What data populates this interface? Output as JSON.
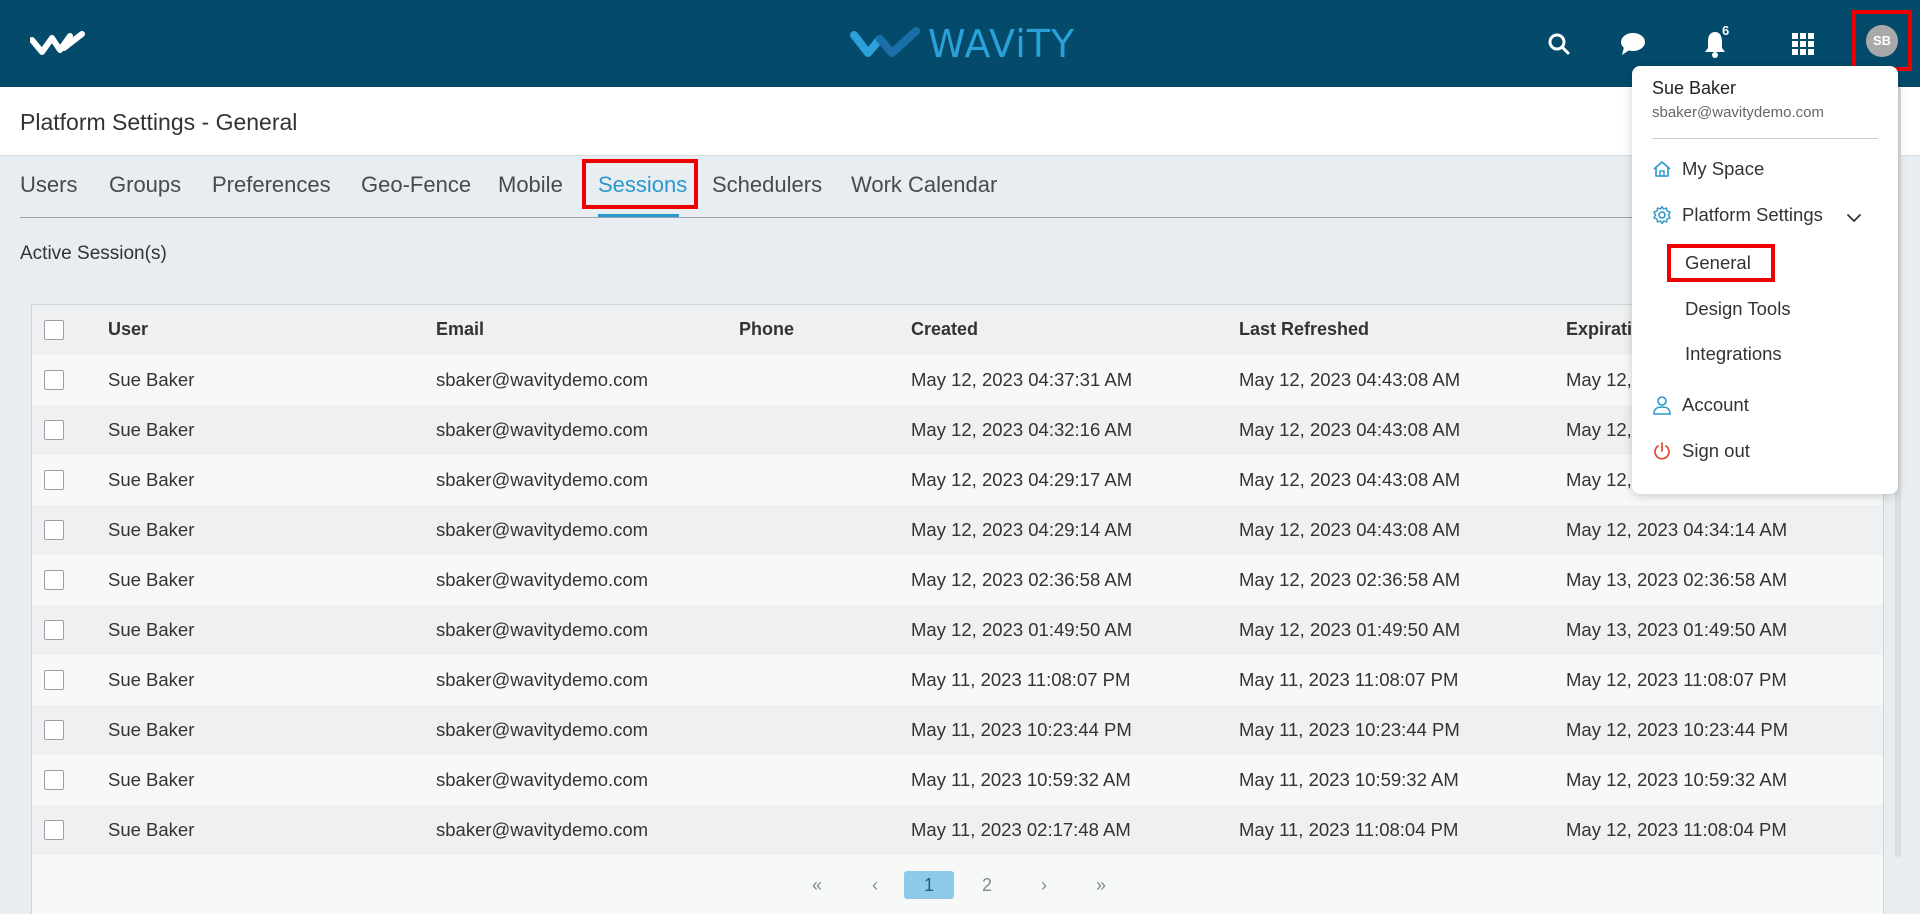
{
  "header": {
    "brand": "WAViTY",
    "notification_count": "6",
    "avatar_initials": "SB"
  },
  "page": {
    "title": "Platform Settings - General",
    "section_label": "Active Session(s)"
  },
  "tabs": [
    {
      "label": "Users"
    },
    {
      "label": "Groups"
    },
    {
      "label": "Preferences"
    },
    {
      "label": "Geo-Fence"
    },
    {
      "label": "Mobile"
    },
    {
      "label": "Sessions"
    },
    {
      "label": "Schedulers"
    },
    {
      "label": "Work Calendar"
    }
  ],
  "table": {
    "columns": [
      "User",
      "Email",
      "Phone",
      "Created",
      "Last Refreshed",
      "Expirati"
    ],
    "rows": [
      {
        "user": "Sue Baker",
        "email": "sbaker@wavitydemo.com",
        "phone": "",
        "created": "May 12, 2023 04:37:31 AM",
        "refreshed": "May 12, 2023 04:43:08 AM",
        "expiration": "May 12,"
      },
      {
        "user": "Sue Baker",
        "email": "sbaker@wavitydemo.com",
        "phone": "",
        "created": "May 12, 2023 04:32:16 AM",
        "refreshed": "May 12, 2023 04:43:08 AM",
        "expiration": "May 12,"
      },
      {
        "user": "Sue Baker",
        "email": "sbaker@wavitydemo.com",
        "phone": "",
        "created": "May 12, 2023 04:29:17 AM",
        "refreshed": "May 12, 2023 04:43:08 AM",
        "expiration": "May 12,"
      },
      {
        "user": "Sue Baker",
        "email": "sbaker@wavitydemo.com",
        "phone": "",
        "created": "May 12, 2023 04:29:14 AM",
        "refreshed": "May 12, 2023 04:43:08 AM",
        "expiration": "May 12, 2023 04:34:14 AM"
      },
      {
        "user": "Sue Baker",
        "email": "sbaker@wavitydemo.com",
        "phone": "",
        "created": "May 12, 2023 02:36:58 AM",
        "refreshed": "May 12, 2023 02:36:58 AM",
        "expiration": "May 13, 2023 02:36:58 AM"
      },
      {
        "user": "Sue Baker",
        "email": "sbaker@wavitydemo.com",
        "phone": "",
        "created": "May 12, 2023 01:49:50 AM",
        "refreshed": "May 12, 2023 01:49:50 AM",
        "expiration": "May 13, 2023 01:49:50 AM"
      },
      {
        "user": "Sue Baker",
        "email": "sbaker@wavitydemo.com",
        "phone": "",
        "created": "May 11, 2023 11:08:07 PM",
        "refreshed": "May 11, 2023 11:08:07 PM",
        "expiration": "May 12, 2023 11:08:07 PM"
      },
      {
        "user": "Sue Baker",
        "email": "sbaker@wavitydemo.com",
        "phone": "",
        "created": "May 11, 2023 10:23:44 PM",
        "refreshed": "May 11, 2023 10:23:44 PM",
        "expiration": "May 12, 2023 10:23:44 PM"
      },
      {
        "user": "Sue Baker",
        "email": "sbaker@wavitydemo.com",
        "phone": "",
        "created": "May 11, 2023 10:59:32 AM",
        "refreshed": "May 11, 2023 10:59:32 AM",
        "expiration": "May 12, 2023 10:59:32 AM"
      },
      {
        "user": "Sue Baker",
        "email": "sbaker@wavitydemo.com",
        "phone": "",
        "created": "May 11, 2023 02:17:48 AM",
        "refreshed": "May 11, 2023 11:08:04 PM",
        "expiration": "May 12, 2023 11:08:04 PM"
      }
    ]
  },
  "pagination": {
    "first": "«",
    "prev": "‹",
    "pages": [
      "1",
      "2"
    ],
    "current": "1",
    "next": "›",
    "last": "»"
  },
  "user_menu": {
    "name": "Sue Baker",
    "email": "sbaker@wavitydemo.com",
    "my_space": "My Space",
    "platform_settings": "Platform Settings",
    "sub_items": [
      "General",
      "Design Tools",
      "Integrations"
    ],
    "account": "Account",
    "sign_out": "Sign out"
  },
  "colors": {
    "header_bg": "#044a6b",
    "accent": "#2a98cc",
    "highlight": "#ee0000"
  },
  "icons": [
    "logo-mark-icon",
    "search-icon",
    "chat-icon",
    "bell-icon",
    "apps-grid-icon",
    "home-icon",
    "gear-icon",
    "chevron-down-icon",
    "user-icon",
    "power-icon"
  ]
}
